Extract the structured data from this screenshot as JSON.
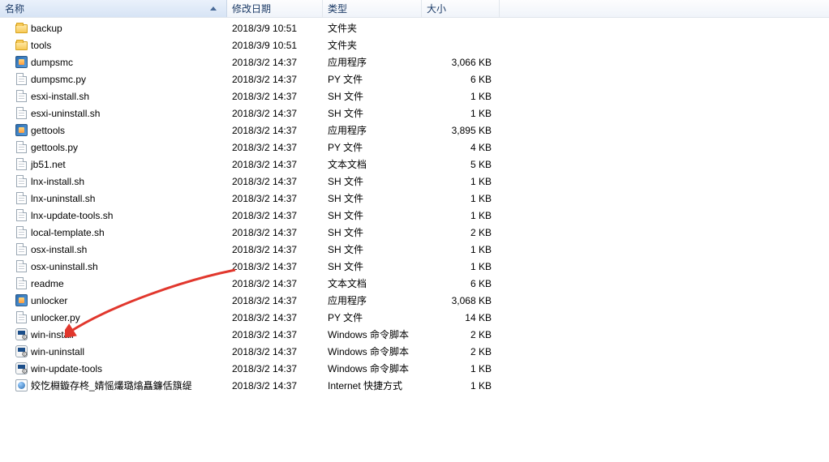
{
  "columns": {
    "name": "名称",
    "date": "修改日期",
    "type": "类型",
    "size": "大小"
  },
  "files": [
    {
      "icon": "folder",
      "name": "backup",
      "date": "2018/3/9 10:51",
      "type": "文件夹",
      "size": ""
    },
    {
      "icon": "folder",
      "name": "tools",
      "date": "2018/3/9 10:51",
      "type": "文件夹",
      "size": ""
    },
    {
      "icon": "exe",
      "name": "dumpsmc",
      "date": "2018/3/2 14:37",
      "type": "应用程序",
      "size": "3,066 KB"
    },
    {
      "icon": "file",
      "name": "dumpsmc.py",
      "date": "2018/3/2 14:37",
      "type": "PY 文件",
      "size": "6 KB"
    },
    {
      "icon": "file",
      "name": "esxi-install.sh",
      "date": "2018/3/2 14:37",
      "type": "SH 文件",
      "size": "1 KB"
    },
    {
      "icon": "file",
      "name": "esxi-uninstall.sh",
      "date": "2018/3/2 14:37",
      "type": "SH 文件",
      "size": "1 KB"
    },
    {
      "icon": "exe",
      "name": "gettools",
      "date": "2018/3/2 14:37",
      "type": "应用程序",
      "size": "3,895 KB"
    },
    {
      "icon": "file",
      "name": "gettools.py",
      "date": "2018/3/2 14:37",
      "type": "PY 文件",
      "size": "4 KB"
    },
    {
      "icon": "file",
      "name": "jb51.net",
      "date": "2018/3/2 14:37",
      "type": "文本文档",
      "size": "5 KB"
    },
    {
      "icon": "file",
      "name": "lnx-install.sh",
      "date": "2018/3/2 14:37",
      "type": "SH 文件",
      "size": "1 KB"
    },
    {
      "icon": "file",
      "name": "lnx-uninstall.sh",
      "date": "2018/3/2 14:37",
      "type": "SH 文件",
      "size": "1 KB"
    },
    {
      "icon": "file",
      "name": "lnx-update-tools.sh",
      "date": "2018/3/2 14:37",
      "type": "SH 文件",
      "size": "1 KB"
    },
    {
      "icon": "file",
      "name": "local-template.sh",
      "date": "2018/3/2 14:37",
      "type": "SH 文件",
      "size": "2 KB"
    },
    {
      "icon": "file",
      "name": "osx-install.sh",
      "date": "2018/3/2 14:37",
      "type": "SH 文件",
      "size": "1 KB"
    },
    {
      "icon": "file",
      "name": "osx-uninstall.sh",
      "date": "2018/3/2 14:37",
      "type": "SH 文件",
      "size": "1 KB"
    },
    {
      "icon": "file",
      "name": "readme",
      "date": "2018/3/2 14:37",
      "type": "文本文档",
      "size": "6 KB"
    },
    {
      "icon": "exe",
      "name": "unlocker",
      "date": "2018/3/2 14:37",
      "type": "应用程序",
      "size": "3,068 KB"
    },
    {
      "icon": "file",
      "name": "unlocker.py",
      "date": "2018/3/2 14:37",
      "type": "PY 文件",
      "size": "14 KB"
    },
    {
      "icon": "cmd",
      "name": "win-install",
      "date": "2018/3/2 14:37",
      "type": "Windows 命令脚本",
      "size": "2 KB"
    },
    {
      "icon": "cmd",
      "name": "win-uninstall",
      "date": "2018/3/2 14:37",
      "type": "Windows 命令脚本",
      "size": "2 KB"
    },
    {
      "icon": "cmd",
      "name": "win-update-tools",
      "date": "2018/3/2 14:37",
      "type": "Windows 命令脚本",
      "size": "1 KB"
    },
    {
      "icon": "url",
      "name": "姣忔棩鏇存柊_婧愮爜璐熻矗鐮佸簱缇",
      "date": "2018/3/2 14:37",
      "type": "Internet 快捷方式",
      "size": "1 KB"
    }
  ]
}
